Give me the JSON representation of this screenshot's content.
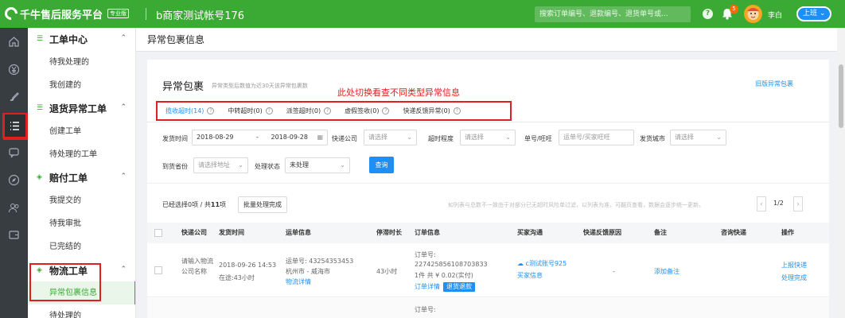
{
  "colors": {
    "brand": "#3aaa35",
    "link": "#1d8ff5",
    "highlight": "#e02020"
  },
  "header": {
    "logo_text": "千牛售后服务平台",
    "pro_badge": "专业版",
    "account": "b商家测试帐号176",
    "search_placeholder": "搜索订单编号、退款编号、退货单号或...",
    "help_label": "?",
    "notify_count": "5",
    "user_name": "李白",
    "duty_label": "上班"
  },
  "icon_bar": [
    "home-icon",
    "yen-icon",
    "brush-icon",
    "list-icon",
    "chat-icon",
    "compass-icon",
    "users-icon",
    "wallet-icon"
  ],
  "sidebar": {
    "groups": [
      {
        "label": "工单中心",
        "items": [
          "待我处理的",
          "我创建的"
        ]
      },
      {
        "label": "退货异常工单",
        "items": [
          "创建工单",
          "待处理的工单"
        ]
      },
      {
        "label": "赔付工单",
        "items": [
          "我提交的",
          "待我审批",
          "已完结的"
        ]
      },
      {
        "label": "物流工单",
        "items": [
          "异常包裹信息",
          "待处理的"
        ]
      }
    ]
  },
  "page": {
    "title": "异常包裹信息"
  },
  "card": {
    "title": "异常包裹",
    "subtitle": "异常类型后数值为近30天该异常包裹数",
    "annotation": "此处切换看查不同类型异常信息",
    "old_link": "旧版异常包裹",
    "tabs": [
      {
        "label": "揽收超时(14)",
        "active": true
      },
      {
        "label": "中转超时(0)",
        "active": false
      },
      {
        "label": "派签超时(0)",
        "active": false
      },
      {
        "label": "虚假签收(0)",
        "active": false
      },
      {
        "label": "快递反馈异常(0)",
        "active": false
      }
    ]
  },
  "filters": {
    "ship_time_label": "发货时间",
    "date_start": "2018-08-29",
    "date_sep": "-",
    "date_end": "2018-09-28",
    "courier_label": "快递公司",
    "courier_placeholder": "请选择",
    "timeout_label": "超时程度",
    "timeout_placeholder": "请选择",
    "order_label": "单号/旺旺",
    "order_placeholder": "运单号/买家旺旺",
    "city_label": "发货城市",
    "city_placeholder": "请选择",
    "province_label": "到货省份",
    "province_placeholder": "请选择地址",
    "status_label": "处理状态",
    "status_value": "未处理",
    "query_button": "查询"
  },
  "selection": {
    "prefix": "已经选择0项 / 共",
    "total": "11",
    "suffix": "项",
    "batch_button": "批量处理完成",
    "notice": "如列表与总数不一致由于对部分已无超时风险单过滤，以列表为准，可翻页查看，数据会逐步统一更新。",
    "page": "1/2",
    "prev": "‹",
    "next": "›"
  },
  "table": {
    "headers": [
      "快递公司",
      "发货时间",
      "运单信息",
      "停滞时长",
      "订单信息",
      "买家沟通",
      "快递反馈原因",
      "备注",
      "咨询快递",
      "操作"
    ],
    "row1": {
      "courier": "请输入物流公司名称",
      "ship_time": "2018-09-26 14:53",
      "transit": "在途:43小时",
      "waybill": "运单号: 43254353453",
      "route": "杭州市 - 威海市",
      "logistics_link": "物流详情",
      "stall": "43小时",
      "order_label": "订单号:",
      "order_no": "227425856108703833",
      "order_amount": "1件 共 ¥ 0.02(实付)",
      "order_link": "订单详情",
      "refund_tag": "退货退款",
      "buyer": "c测试账号925",
      "buyer_info": "买家信息",
      "reason": "-",
      "remark": "添加备注",
      "op1": "上报快递",
      "op2": "处理完成"
    },
    "row2": {
      "order_label": "订单号:"
    }
  }
}
